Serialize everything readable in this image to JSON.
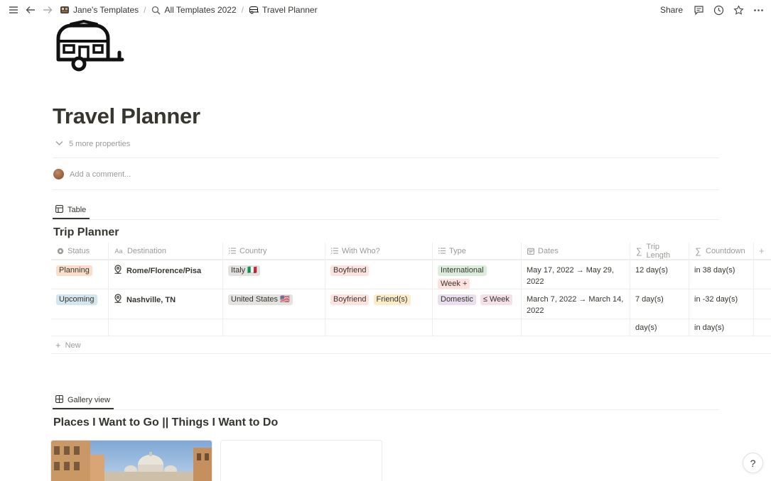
{
  "breadcrumb": {
    "workspace": "Jane's Templates",
    "parent": "All Templates 2022",
    "current": "Travel Planner"
  },
  "topbar": {
    "share_label": "Share"
  },
  "page": {
    "title": "Travel Planner",
    "more_properties": "5 more properties",
    "comment_placeholder": "Add a comment..."
  },
  "table_view": {
    "tab_label": "Table",
    "title": "Trip Planner",
    "columns": [
      "Status",
      "Destination",
      "Country",
      "With Who?",
      "Type",
      "Dates",
      "Trip Length",
      "Countdown"
    ],
    "rows": [
      {
        "status": "Planning",
        "destination": "Rome/Florence/Pisa",
        "country": "Italy 🇮🇹",
        "with_who": [
          "Boyfriend"
        ],
        "type": [
          "International",
          "Week +"
        ],
        "dates": "May 17, 2022 → May 29, 2022",
        "trip_length": "12 day(s)",
        "countdown": "in 38 day(s)"
      },
      {
        "status": "Upcoming",
        "destination": "Nashville, TN",
        "country": "United States 🇺🇸",
        "with_who": [
          "Boyfriend",
          "Friend(s)"
        ],
        "type": [
          "Domestic",
          "≤ Week"
        ],
        "dates": "March 7, 2022 → March 14, 2022",
        "trip_length": "7 day(s)",
        "countdown": "in -32 day(s)"
      },
      {
        "trip_length": "day(s)",
        "countdown": "in  day(s)"
      }
    ],
    "new_label": "New"
  },
  "gallery_view": {
    "tab_label": "Gallery view",
    "title": "Places I Want to Go || Things I Want to Do"
  },
  "help_label": "?",
  "colors": {
    "planning_bg": "#fadec9",
    "upcoming_bg": "#d3e5ef",
    "boyfriend_bg": "#ffe2dd",
    "friends_bg": "#fdecc8",
    "international_bg": "#dbeddb",
    "week_plus_bg": "#ffe2dd",
    "domestic_bg": "#e8deee",
    "le_week_bg": "#f5e0e9",
    "country_bg": "#e3e2e0"
  }
}
